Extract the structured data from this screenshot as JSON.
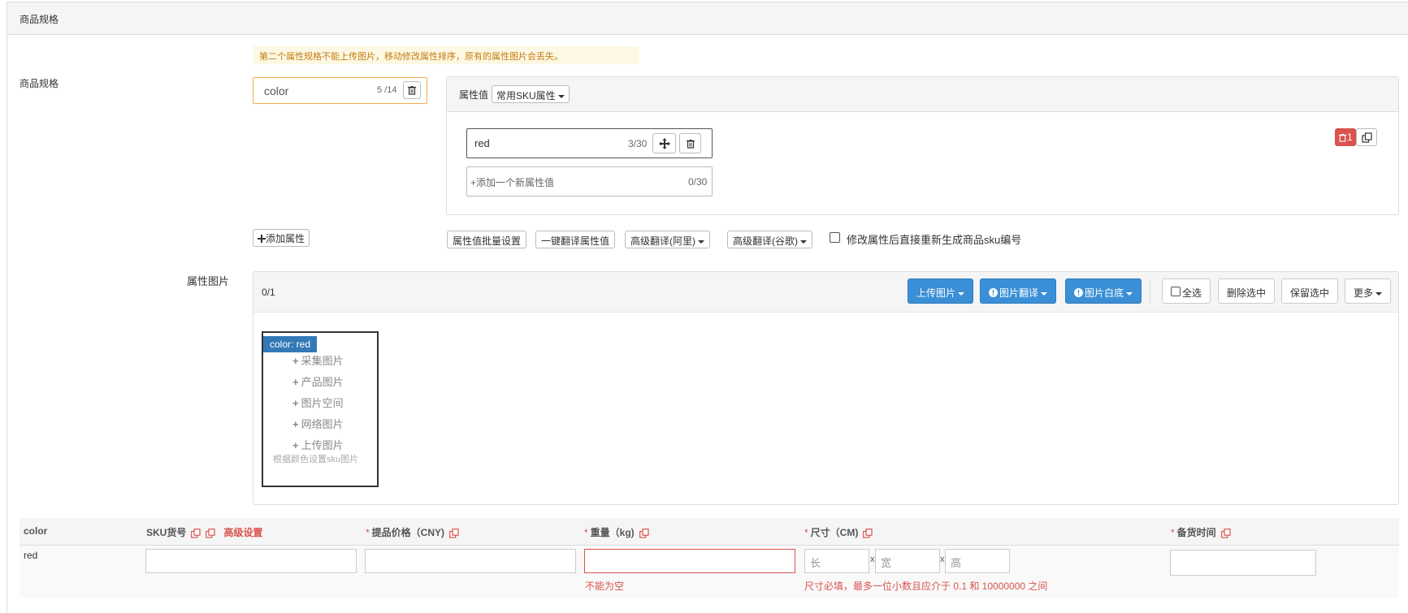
{
  "panel": {
    "title": "商品规格"
  },
  "warning": "第二个属性规格不能上传图片，移动修改属性排序，原有的属性图片会丢失。",
  "spec": {
    "label": "商品规格",
    "name_value": "color",
    "name_count": "5 /14",
    "values_label": "属性值",
    "common_sku_label": "常用SKU属性",
    "values": [
      {
        "value": "red",
        "count": "3/30"
      }
    ],
    "new_value_placeholder": "+添加一个新属性值",
    "new_value_count": "0/30",
    "delete_badge": "1"
  },
  "actions": {
    "add_attr": "添加属性",
    "batch_set": "属性值批量设置",
    "one_click_translate": "一键翻译属性值",
    "adv_translate_ali": "高级翻译(阿里)",
    "adv_translate_google": "高级翻译(谷歌)",
    "regen_sku_label": "修改属性后直接重新生成商品sku编号"
  },
  "images": {
    "label": "属性图片",
    "count": "0/1",
    "upload": "上传图片",
    "translate": "图片翻译",
    "white_bg": "图片白底",
    "select_all": "全选",
    "delete_selected": "删除选中",
    "keep_selected": "保留选中",
    "more": "更多",
    "card": {
      "tag": "color: red",
      "items": [
        "采集图片",
        "产品图片",
        "图片空间",
        "网络图片",
        "上传图片"
      ],
      "note": "根据颜色设置sku图片"
    }
  },
  "sku_table": {
    "headers": {
      "color": "color",
      "sku_no": "SKU货号",
      "advanced": "高级设置",
      "price": "提品价格（CNY)",
      "weight": "重量（kg)",
      "size": "尺寸（CM)",
      "stock_time": "备货时间"
    },
    "row": {
      "color": "red",
      "len_placeholder": "长",
      "wid_placeholder": "宽",
      "hei_placeholder": "高",
      "x": "x"
    },
    "errors": {
      "weight": "不能为空",
      "size": "尺寸必填，最多一位小数且应介于 0.1 和 10000000 之间"
    }
  },
  "colors": {
    "primary": "#3b8fd6",
    "danger": "#d9534f",
    "warning_bg": "#fcf8e3",
    "warning_text": "#c77c13"
  }
}
